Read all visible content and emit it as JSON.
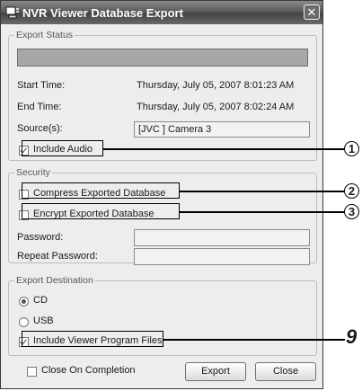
{
  "window": {
    "title": "NVR Viewer Database Export",
    "close_glyph": "✕"
  },
  "export_status": {
    "legend": "Export Status",
    "start_label": "Start Time:",
    "start_value": "Thursday, July 05, 2007 8:01:23 AM",
    "end_label": "End Time:",
    "end_value": "Thursday, July 05, 2007 8:02:24 AM",
    "source_label": "Source(s):",
    "source_value": "[JVC ] Camera 3",
    "include_audio_label": "Include Audio",
    "include_audio_checked": true
  },
  "security": {
    "legend": "Security",
    "compress_label": "Compress Exported Database",
    "compress_checked": false,
    "encrypt_label": "Encrypt Exported Database",
    "encrypt_checked": false,
    "password_label": "Password:",
    "password_value": "",
    "repeat_label": "Repeat Password:",
    "repeat_value": ""
  },
  "export_destination": {
    "legend": "Export Destination",
    "options": [
      {
        "label": "CD",
        "selected": true
      },
      {
        "label": "USB",
        "selected": false
      }
    ],
    "include_viewer_label": "Include Viewer Program Files",
    "include_viewer_checked": true
  },
  "footer": {
    "close_on_completion_label": "Close On Completion",
    "close_on_completion_checked": false,
    "export_button": "Export",
    "close_button": "Close"
  },
  "callouts": [
    "1",
    "2",
    "3",
    "9"
  ],
  "icons": {
    "title": "nvr-app-icon",
    "close": "close-icon"
  }
}
